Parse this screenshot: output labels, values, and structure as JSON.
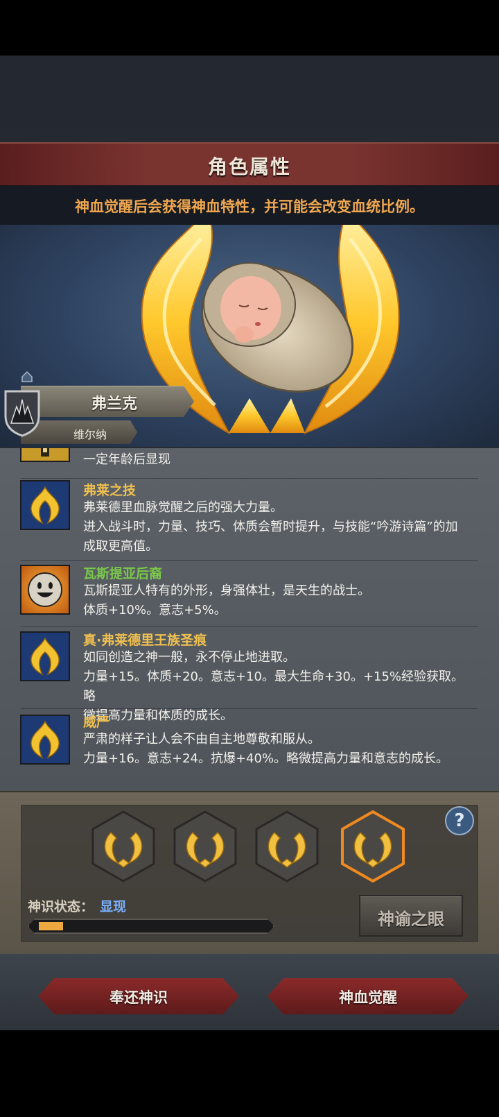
{
  "header": {
    "title": "角色属性",
    "hint": "神血觉醒后会获得神血特性，并可能会改变血统比例。"
  },
  "character": {
    "name": "弗兰克",
    "family": "维尔纳"
  },
  "traits": [
    {
      "title": "",
      "desc": [
        "一定年龄后显现"
      ],
      "icon": "locked-trait-icon"
    },
    {
      "title": "弗莱之技",
      "title_color": "#f0c050",
      "desc": [
        "弗莱德里血脉觉醒之后的强大力量。",
        "进入战斗时，力量、技巧、体质会暂时提升，与技能“吟游诗篇”的加",
        "成取更高值。"
      ],
      "icon": "golden-crest-icon"
    },
    {
      "title": "瓦斯提亚后裔",
      "title_color": "#7ac84a",
      "desc": [
        "瓦斯提亚人特有的外形，身强体壮，是天生的战士。",
        "体质+10%。意志+5%。"
      ],
      "icon": "smiley-face-icon"
    },
    {
      "title": "真·弗莱德里王族圣痕",
      "title_color": "#f0c050",
      "desc": [
        "如同创造之神一般，永不停止地进取。",
        "力量+15。体质+20。意志+10。最大生命+30。+15%经验获取。略",
        "微提高力量和体质的成长。"
      ],
      "icon": "golden-crest-icon"
    },
    {
      "title": "威严",
      "title_color": "#f0c050",
      "desc": [
        "严肃的样子让人会不由自主地尊敬和服从。",
        "力量+16。意志+24。抗爆+40%。略微提高力量和意志的成长。"
      ],
      "icon": "golden-crest-icon"
    }
  ],
  "divine": {
    "slots": 4,
    "selected_slot": 4,
    "help": "?",
    "status_label": "神识状态：",
    "status_value": "显现",
    "progress": 0.1,
    "eye_button": "神谕之眼"
  },
  "footer": {
    "return_button": "奉还神识",
    "awaken_button": "神血觉醒"
  },
  "colors": {
    "accent_gold": "#f0c050",
    "hint_orange": "#f0a850",
    "status_blue": "#7ab0ff",
    "button_red": "#8a2a2a"
  }
}
